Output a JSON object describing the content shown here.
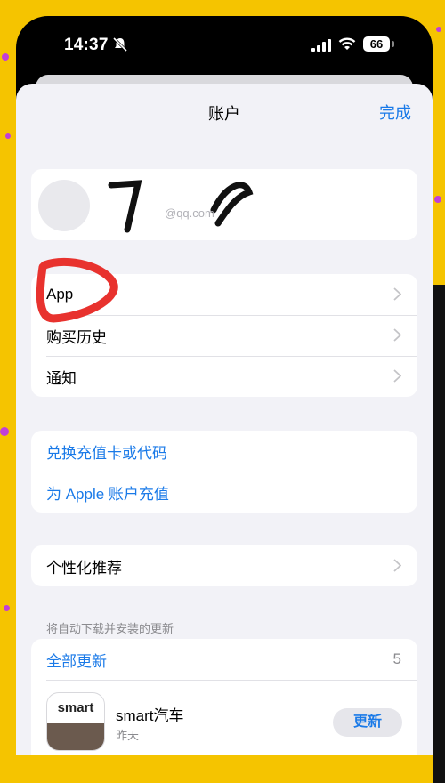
{
  "status_bar": {
    "time": "14:37",
    "battery": "66"
  },
  "nav": {
    "title": "账户",
    "done": "完成"
  },
  "profile": {
    "email": "@qq.com"
  },
  "menu": [
    {
      "label": "App"
    },
    {
      "label": "购买历史"
    },
    {
      "label": "通知"
    }
  ],
  "redeem": [
    {
      "label": "兑换充值卡或代码"
    },
    {
      "label": "为 Apple 账户充值"
    }
  ],
  "personalized": {
    "label": "个性化推荐"
  },
  "updates_section": {
    "header": "将自动下载并安装的更新",
    "update_all": "全部更新",
    "count": "5",
    "apps": [
      {
        "icon_word": "smart",
        "name": "smart汽车",
        "date": "昨天",
        "action": "更新"
      }
    ]
  },
  "colors": {
    "accent": "#1a7ae8",
    "background": "#f5c400",
    "annotation": "#e8322e"
  }
}
